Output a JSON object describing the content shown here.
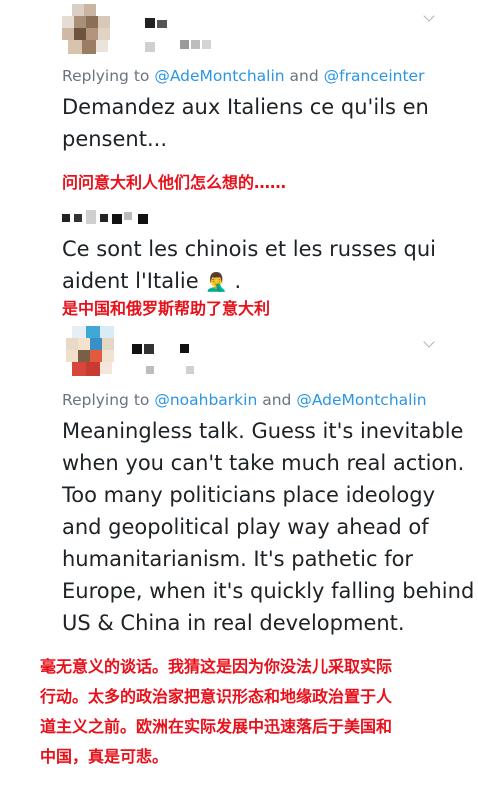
{
  "tweets": [
    {
      "reply_prefix": "Replying to",
      "reply_mention_1": "@AdeMontchalin",
      "reply_and": "and",
      "reply_mention_2": "@franceinter",
      "lines": [
        "Demandez aux Italiens ce qu'ils en",
        "pensent..."
      ],
      "translation": "问问意大利人他们怎么想的……"
    },
    {
      "lines": [
        "Ce sont les chinois et les russes qui",
        "aident l'Italie"
      ],
      "emoji": "🤦‍♂️",
      "end_punct": ".",
      "translation": "是中国和俄罗斯帮助了意大利"
    },
    {
      "reply_prefix": "Replying to",
      "reply_mention_1": "@noahbarkin",
      "reply_and": "and",
      "reply_mention_2": "@AdeMontchalin",
      "lines": [
        "Meaningless talk. Guess it's inevitable",
        "when you can't take much real action.",
        "Too many politicians place ideology",
        "and geopolitical play way ahead of",
        "humanitarianism. It's pathetic for",
        "Europe, when it's quickly falling behind",
        "US & China in real development."
      ],
      "translation_lines": [
        "毫无意义的谈话。我猜这是因为你没法儿采取实际",
        "行动。太多的政治家把意识形态和地缘政治置于人",
        "道主义之前。欧洲在实际发展中迅速落后于美国和",
        "中国，真是可悲。"
      ]
    }
  ],
  "icons": {
    "menu_chevron": "chevron-down-icon",
    "facepalm": "facepalm-emoji-icon"
  },
  "colors": {
    "mention": "#2b96e3",
    "muted": "#6a7480",
    "text": "#1c2226",
    "translation": "#e8101a"
  }
}
